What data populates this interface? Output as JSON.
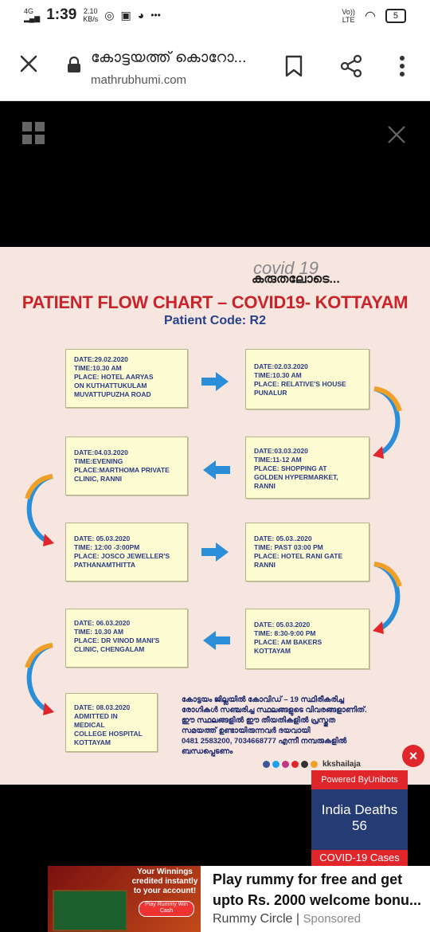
{
  "status_bar": {
    "network": "4G",
    "time": "1:39",
    "speed_value": "2.10",
    "speed_unit": "KB/s",
    "more": "•••",
    "volte": "Vo))",
    "lte": "LTE",
    "battery": "5"
  },
  "browser": {
    "page_title": "കോട്ടയത്ത് കൊറോ...",
    "domain": "mathrubhumi.com"
  },
  "image": {
    "brand_line1": "covid 19",
    "brand_line2": "കരുതലോടെ...",
    "title": "PATIENT FLOW CHART – COVID19- KOTTAYAM",
    "patient_code": "Patient Code: R2",
    "boxes": [
      {
        "lines": [
          "DATE:29.02.2020",
          "TIME:10.30 AM",
          "PLACE: HOTEL AARYAS",
          "ON KUTHATTUKULAM",
          "MUVATTUPUZHA ROAD"
        ]
      },
      {
        "lines": [
          "DATE:02.03.2020",
          "TIME:10.30 AM",
          "PLACE: RELATIVE'S HOUSE",
          "PUNALUR"
        ]
      },
      {
        "lines": [
          "DATE:04.03.2020",
          "TIME:EVENING",
          "PLACE:MARTHOMA PRIVATE",
          "CLINIC, RANNI"
        ]
      },
      {
        "lines": [
          "DATE:03.03.2020",
          "TIME:11-12 AM",
          "PLACE: SHOPPING AT",
          "GOLDEN HYPERMARKET,",
          "RANNI"
        ]
      },
      {
        "lines": [
          "DATE: 05.03.2020",
          "TIME: 12:00 -3:00PM",
          "PLACE: JOSCO JEWELLER'S",
          "PATHANAMTHITTA"
        ]
      },
      {
        "lines": [
          "DATE: 05.03..2020",
          "TIME: PAST 03:00 PM",
          "PLACE: HOTEL RANI GATE",
          "RANNI"
        ]
      },
      {
        "lines": [
          "DATE: 06.03.2020",
          "TIME: 10.30 AM",
          "PLACE: Dr VINOD MANI'S",
          "CLINIC, CHENGALAM"
        ]
      },
      {
        "lines": [
          "DATE: 05.03.2020",
          "TIME: 8:30-9:00 PM",
          "PLACE: AM BAKERS",
          "KOTTAYAM"
        ]
      },
      {
        "lines": [
          "DATE: 08.03.2020",
          "ADMITTED IN MEDICAL",
          "COLLEGE HOSPITAL",
          "KOTTAYAM"
        ]
      }
    ],
    "note_lines": [
      "കോട്ടയം ജില്ലയിൽ കോവിഡ് – 19 സ്ഥിരീകരിച്ച",
      "രോഗികൾ സഞ്ചരിച്ച സ്ഥലങ്ങളുടെ വിവരങ്ങളാണിത്.",
      "ഈ സ്ഥലങ്ങളിൽ ഈ തീയതികളിൽ പ്രസ്തുത",
      "സമയത്ത് ഉണ്ടായിരുന്നവർ ദയവായി",
      "0481 2583200, 7034668777 എന്നീ നമ്പരുകളിൽ",
      "ബന്ധപ്പെടണം"
    ],
    "handle": "kkshailaja",
    "colors": {
      "title": "#c8242a",
      "text": "#2b3c85",
      "arrow": "#2a8fd8"
    }
  },
  "widget": {
    "close": "×",
    "powered": "Powered ByUnibots",
    "label": "India Deaths",
    "value": "56",
    "footer": "COVID-19 Cases"
  },
  "ad": {
    "thumb_text1": "Your Winnings",
    "thumb_text2": "credited instantly",
    "thumb_text3": "to your account!",
    "thumb_button": "Play Rummy Win Cash",
    "headline_line1": "Play rummy for free and get",
    "headline_line2": "upto Rs. 2000 welcome bonu...",
    "advertiser": "Rummy Circle",
    "sponsored": "Sponsored"
  }
}
